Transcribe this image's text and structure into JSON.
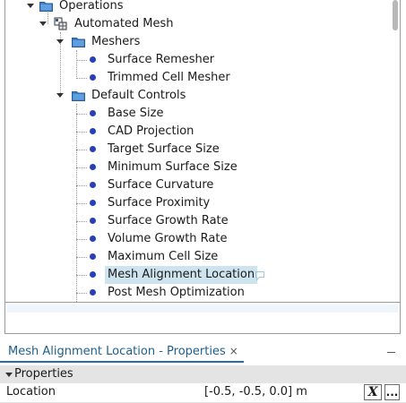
{
  "tree": {
    "operations": "Operations",
    "automated_mesh": "Automated Mesh",
    "meshers": "Meshers",
    "mesher_items": [
      "Surface Remesher",
      "Trimmed Cell Mesher"
    ],
    "default_controls": "Default Controls",
    "control_items": [
      "Base Size",
      "CAD Projection",
      "Target Surface Size",
      "Minimum Surface Size",
      "Surface Curvature",
      "Surface Proximity",
      "Surface Growth Rate",
      "Volume Growth Rate",
      "Maximum Cell Size",
      "Mesh Alignment Location",
      "Post Mesh Optimization"
    ],
    "selected_item": "Mesh Alignment Location"
  },
  "properties": {
    "tab_title": "Mesh Alignment Location - Properties",
    "close_glyph": "×",
    "group": "Properties",
    "row_name": "Location",
    "row_value": "[-0.5, -0.5, 0.0] m",
    "expression_button": "X",
    "more_button": "..."
  },
  "colors": {
    "bullet": "#2a3fb7",
    "folder": "#3b7fc8",
    "selection": "#cde4ef",
    "tab_text": "#1f5f8e"
  },
  "icons": {
    "folder": "folder-icon",
    "bullet": "node-bullet-icon",
    "automated_mesh": "automated-mesh-icon",
    "comment": "comment-bubble-icon"
  }
}
